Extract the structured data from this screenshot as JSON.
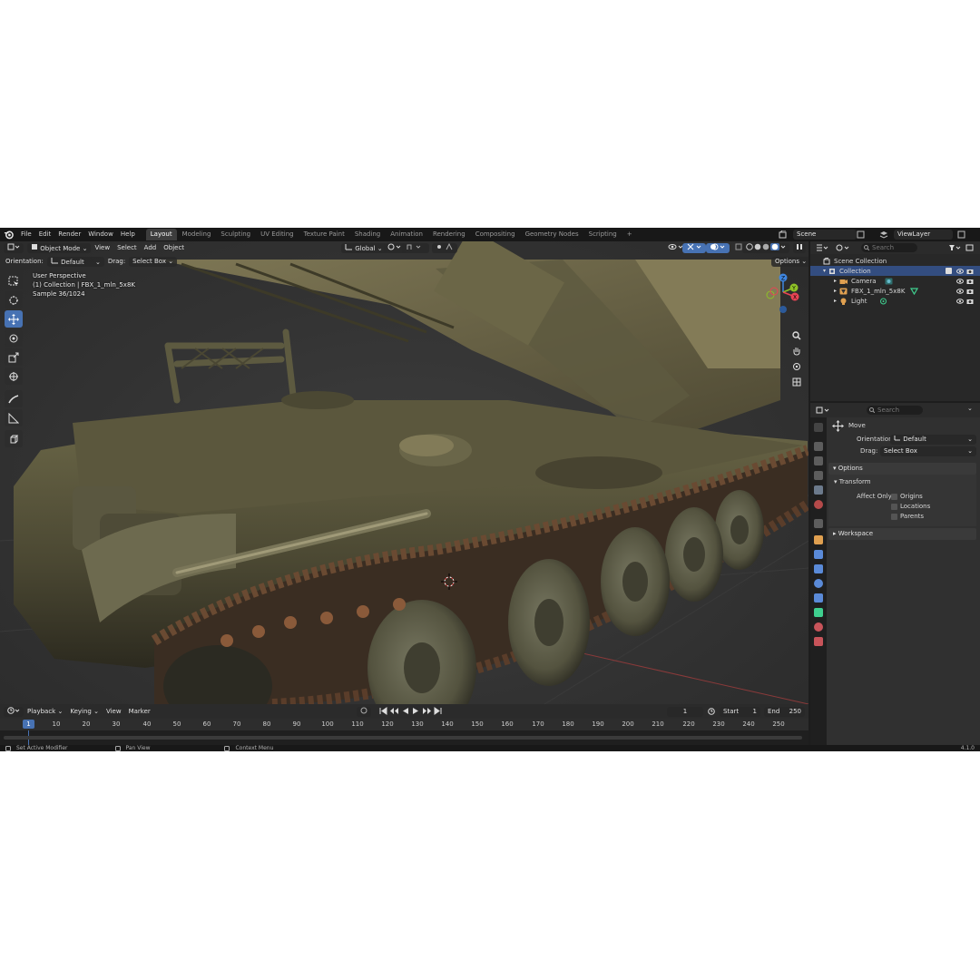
{
  "menu": [
    "File",
    "Edit",
    "Render",
    "Window",
    "Help"
  ],
  "workspaces": [
    "Layout",
    "Modeling",
    "Sculpting",
    "UV Editing",
    "Texture Paint",
    "Shading",
    "Animation",
    "Rendering",
    "Compositing",
    "Geometry Nodes",
    "Scripting"
  ],
  "add_workspace": "+",
  "scene_name": "Scene",
  "view_layer": "ViewLayer",
  "viewport_header": {
    "mode": "Object Mode",
    "view": "View",
    "select": "Select",
    "add": "Add",
    "object": "Object",
    "transform_orientation": "Global",
    "options": "Options"
  },
  "tool_settings": {
    "orientation_label": "Orientation:",
    "orientation_value": "Default",
    "drag_label": "Drag:",
    "drag_value": "Select Box"
  },
  "overlay_text": {
    "view_name": "User Perspective",
    "collection": "(1) Collection | FBX_1_mln_5x8K",
    "sample": "Sample 36/1024"
  },
  "gizmo_axes": [
    "Z",
    "Y",
    "X"
  ],
  "timeline": {
    "playback": "Playback",
    "keying": "Keying",
    "view": "View",
    "marker": "Marker",
    "current_frame": "1",
    "start_label": "Start",
    "start_value": "1",
    "end_label": "End",
    "end_value": "250",
    "ruler_current": "1",
    "ticks": [
      "10",
      "20",
      "30",
      "40",
      "50",
      "60",
      "70",
      "80",
      "90",
      "100",
      "110",
      "120",
      "130",
      "140",
      "150",
      "160",
      "170",
      "180",
      "190",
      "200",
      "210",
      "220",
      "230",
      "240",
      "250"
    ]
  },
  "statusbar": {
    "hint_left": "Set Active Modifier",
    "hint_middle": "Pan View",
    "hint_right": "Context Menu",
    "version": "4.1.0"
  },
  "outliner": {
    "search_placeholder": "Search",
    "scene_collection": "Scene Collection",
    "collection": "Collection",
    "items": [
      "Camera",
      "FBX_1_mln_5x8K",
      "Light"
    ]
  },
  "properties": {
    "search_placeholder": "Search",
    "tool_name": "Move",
    "orientation_label": "Orientation",
    "orientation_value": "Default",
    "drag_label": "Drag:",
    "drag_value": "Select Box",
    "options_panel": "Options",
    "transform_subpanel": "Transform",
    "affect_only_label": "Affect Only",
    "affect_only_options": [
      "Origins",
      "Locations",
      "Parents"
    ],
    "workspace_panel": "Workspace"
  },
  "colors": {
    "accent_blue": "#4772b3",
    "axis_x": "#e84454",
    "axis_y": "#8ec127",
    "axis_z": "#3f86e0",
    "selected_row": "#334d80"
  }
}
